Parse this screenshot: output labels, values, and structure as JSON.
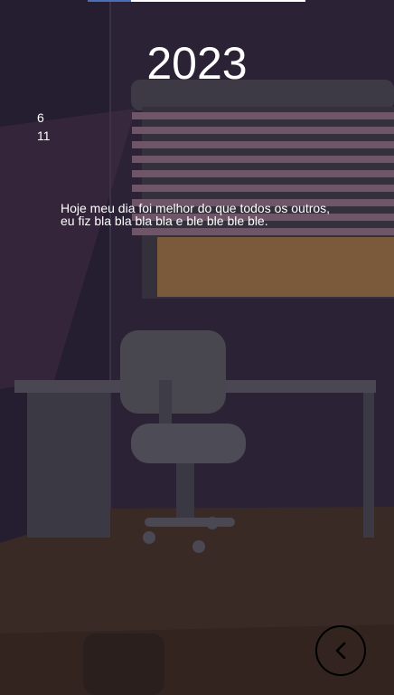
{
  "progress": {
    "fraction": 0.2
  },
  "diary": {
    "year": "2023",
    "day": "6",
    "month": "11",
    "text": "Hoje meu dia foi melhor do que todos os outros, eu fiz bla bla bla bla e ble ble ble ble."
  },
  "back_button": {
    "icon": "chevron-left-icon"
  },
  "colors": {
    "wall": "#2b2236",
    "floor": "#3a2a26",
    "desk": "#3b3944",
    "window_glow": "#7a5a3b",
    "accent": "#4a6fb8"
  }
}
